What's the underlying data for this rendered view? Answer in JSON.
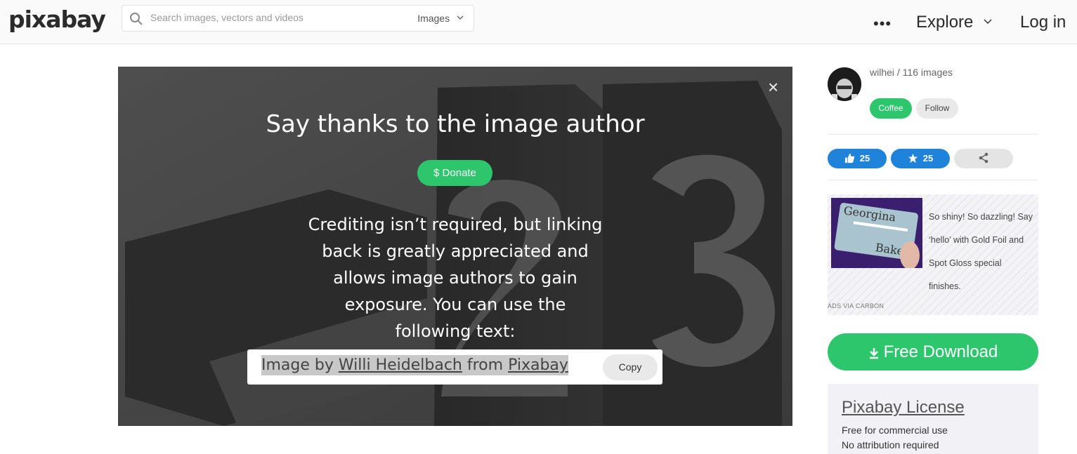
{
  "header": {
    "logo": "pixabay",
    "search": {
      "placeholder": "Search images, vectors and videos",
      "type": "Images"
    },
    "more": "•••",
    "explore": "Explore",
    "login": "Log in"
  },
  "modal": {
    "close": "×",
    "title": "Say thanks to the image author",
    "donate_label": "$ Donate",
    "body": "Crediting isn’t required, but linking back is greatly appreciated and allows image authors to gain exposure. You can use the following text:",
    "credit": {
      "prefix": "Image by ",
      "author": "Willi Heidelbach",
      "middle": " from ",
      "site": "Pixabay"
    },
    "copy_label": "Copy"
  },
  "sidebar": {
    "author": "wilhei / 116 images",
    "coffee_label": "Coffee",
    "follow_label": "Follow",
    "likes": "25",
    "favorites": "25",
    "ad": {
      "image_text": [
        "Georgina",
        "Bake"
      ],
      "text": "So shiny! So dazzling! Say ‘hello’ with Gold Foil and Spot Gloss special finishes.",
      "via": "ADS VIA CARBON"
    },
    "download_label": "Free Download",
    "license": {
      "title": "Pixabay License",
      "line1": "Free for commercial use",
      "line2": "No attribution required"
    }
  },
  "colors": {
    "green": "#2ec66d",
    "blue": "#1f84d9"
  }
}
